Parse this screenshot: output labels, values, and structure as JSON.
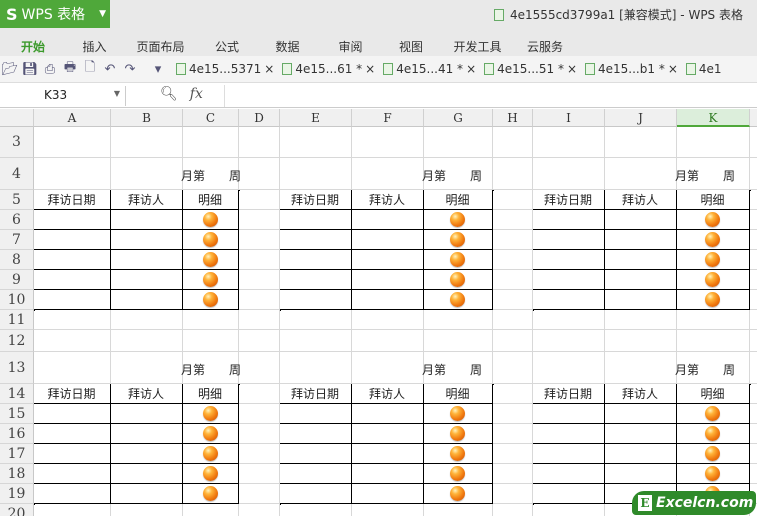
{
  "app": {
    "name": "WPS 表格",
    "logo": "S",
    "window_title": "4e1555cd3799a1 [兼容模式] - WPS 表格"
  },
  "ribbon_tabs": [
    {
      "label": "开始",
      "active": true
    },
    {
      "label": "插入"
    },
    {
      "label": "页面布局"
    },
    {
      "label": "公式"
    },
    {
      "label": "数据"
    },
    {
      "label": "审阅"
    },
    {
      "label": "视图"
    },
    {
      "label": "开发工具"
    },
    {
      "label": "云服务"
    }
  ],
  "toolbar_icons": [
    "open-folder-icon",
    "save-icon",
    "export-pdf-icon",
    "print-icon",
    "print-preview-icon",
    "undo-icon",
    "redo-icon",
    "more-dropdown-icon"
  ],
  "doc_tabs": [
    {
      "label": "4e15...5371",
      "close": "×"
    },
    {
      "label": "4e15...61 *",
      "close": "×"
    },
    {
      "label": "4e15...41 *",
      "close": "×"
    },
    {
      "label": "4e15...51 *",
      "close": "×"
    },
    {
      "label": "4e15...b1 *",
      "close": "×"
    },
    {
      "label": "4e1",
      "close": ""
    }
  ],
  "formula_bar": {
    "name_box": "K33",
    "fx": "fx",
    "value": ""
  },
  "columns": [
    "A",
    "B",
    "C",
    "D",
    "E",
    "F",
    "G",
    "H",
    "I",
    "J",
    "K"
  ],
  "selected_column": "K",
  "rows": [
    "3",
    "4",
    "5",
    "6",
    "7",
    "8",
    "9",
    "10",
    "11",
    "12",
    "13",
    "14",
    "15",
    "16",
    "17",
    "18",
    "19",
    "20"
  ],
  "block": {
    "week_label": "月第　　周",
    "headers": [
      "拜访日期",
      "拜访人",
      "明细"
    ]
  },
  "watermark": "Excelcn.com",
  "watermark_badge": "E"
}
